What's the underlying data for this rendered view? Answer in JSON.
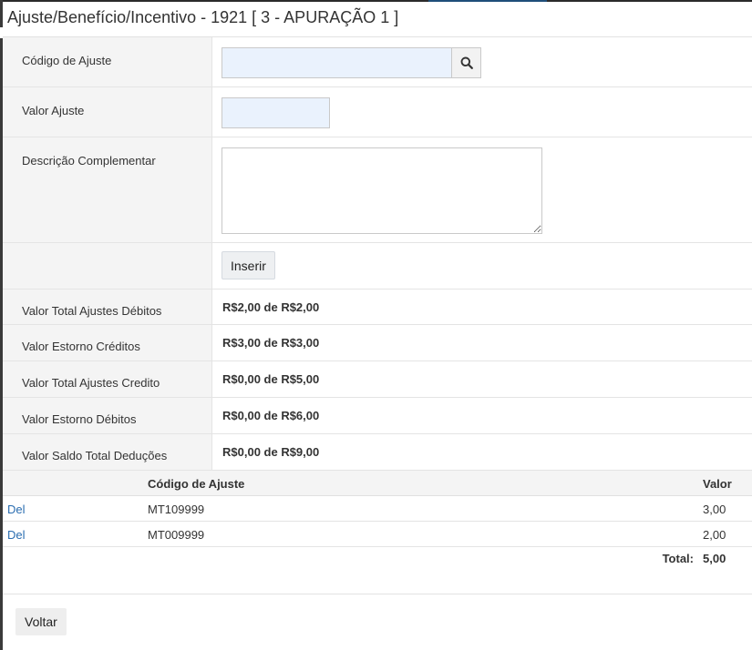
{
  "modal": {
    "title": "Ajuste/Benefício/Incentivo - 1921 [ 3 - APURAÇÃO 1 ]"
  },
  "form": {
    "codigo_label": "Código de Ajuste",
    "codigo_value": "",
    "valor_label": "Valor Ajuste",
    "valor_value": "",
    "descricao_label": "Descrição Complementar",
    "descricao_value": "",
    "inserir_label": "Inserir",
    "search_icon": "search-icon"
  },
  "summary": [
    {
      "label": "Valor Total Ajustes Débitos",
      "value": "R$2,00 de R$2,00"
    },
    {
      "label": "Valor Estorno Créditos",
      "value": "R$3,00 de R$3,00"
    },
    {
      "label": "Valor Total Ajustes Credito",
      "value": "R$0,00 de R$5,00"
    },
    {
      "label": "Valor Estorno Débitos",
      "value": "R$0,00 de R$6,00"
    },
    {
      "label": "Valor Saldo Total Deduções",
      "value": "R$0,00 de R$9,00"
    }
  ],
  "grid": {
    "columns": {
      "action": "",
      "code": "Código de Ajuste",
      "value": "Valor"
    },
    "rows": [
      {
        "action": "Del",
        "code": "MT109999",
        "value": "3,00"
      },
      {
        "action": "Del",
        "code": "MT009999",
        "value": "2,00"
      }
    ],
    "total_label": "Total:",
    "total_value": "5,00"
  },
  "footer": {
    "voltar_label": "Voltar"
  },
  "colors": {
    "link": "#2a6db0",
    "input_bg": "#eaf2fd",
    "label_bg": "#f4f4f4"
  }
}
